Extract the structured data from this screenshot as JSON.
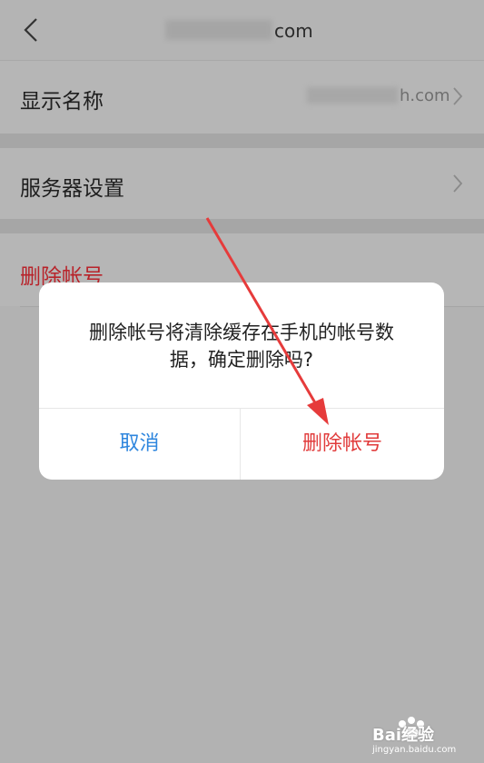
{
  "header": {
    "title_suffix": "com"
  },
  "settings": {
    "display_name_label": "显示名称",
    "display_name_value_suffix": "h.com",
    "server_settings_label": "服务器设置",
    "delete_account_label": "删除帐号"
  },
  "dialog": {
    "message": "删除帐号将清除缓存在手机的帐号数据，确定删除吗?",
    "cancel_label": "取消",
    "confirm_label": "删除帐号"
  },
  "watermark": {
    "brand": "Bai经验",
    "site": "jingyan.baidu.com"
  },
  "colors": {
    "danger": "#e13b3b",
    "link": "#2e86de",
    "arrow": "#e63b3b"
  }
}
